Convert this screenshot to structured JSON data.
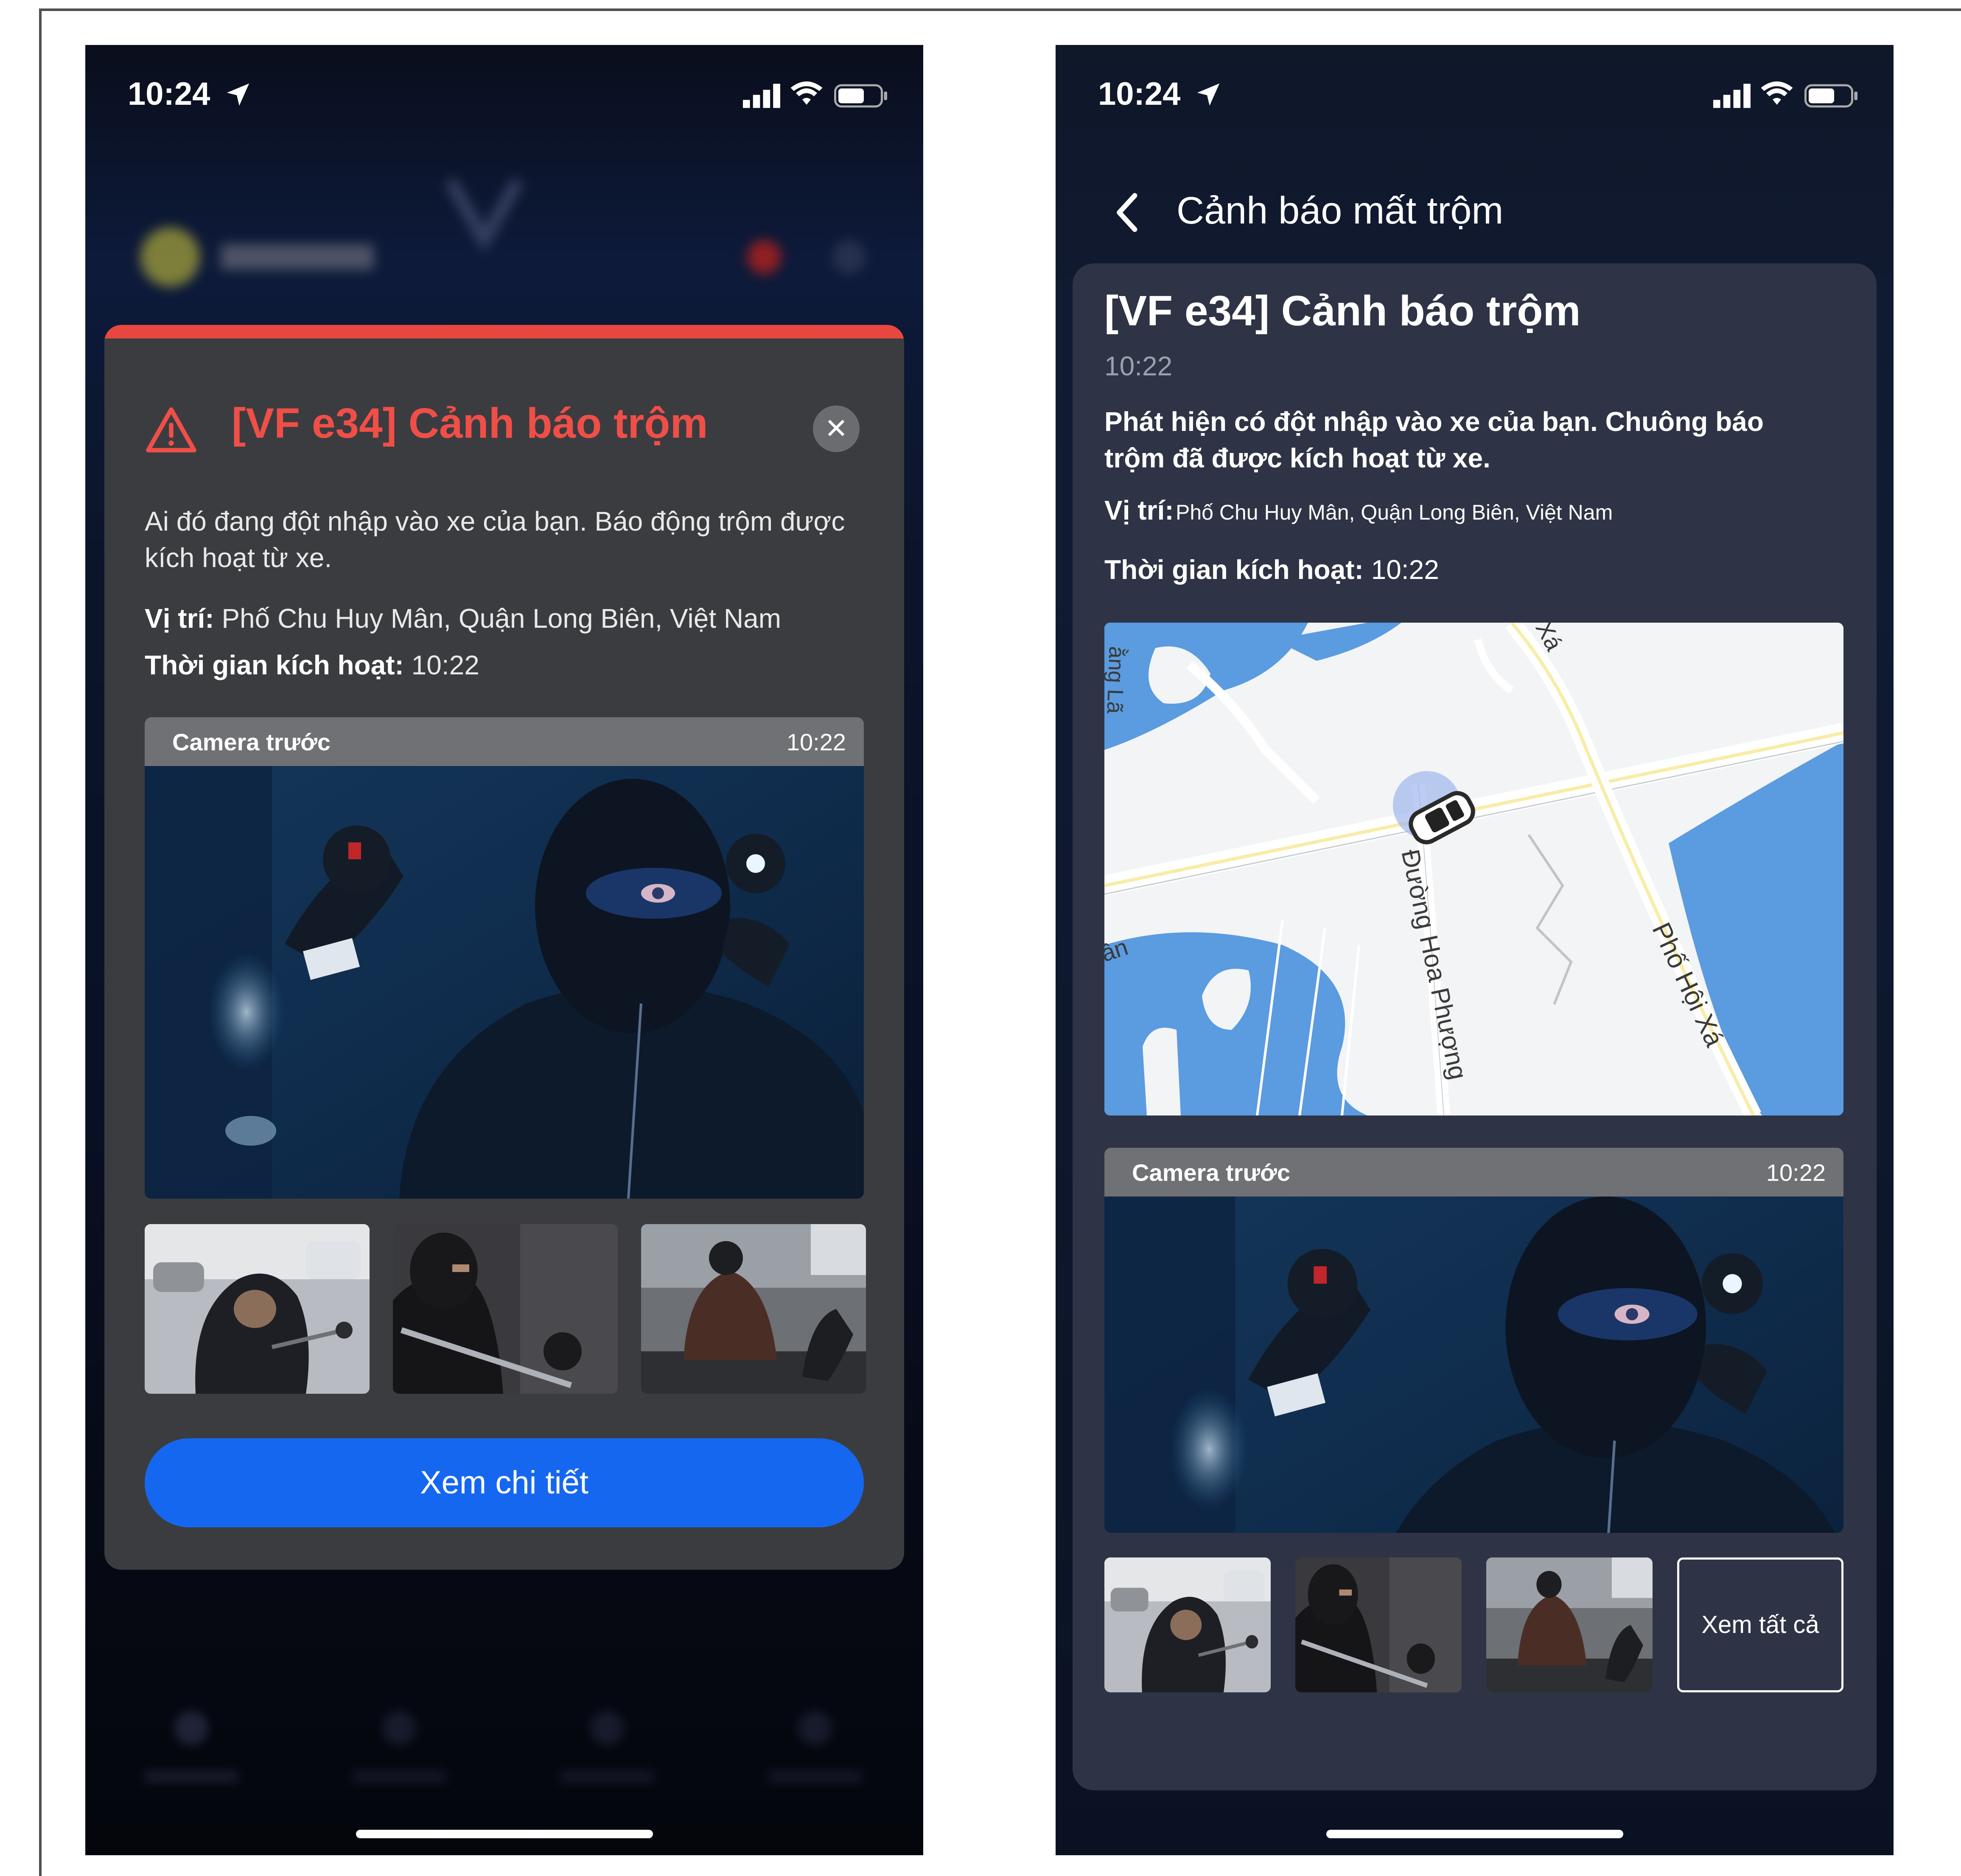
{
  "status_bar": {
    "time": "10:24"
  },
  "alert_popup": {
    "title": "[VF e34] Cảnh báo trộm",
    "description": "Ai đó đang đột nhập vào xe của bạn. Báo động trộm được kích hoạt từ xe.",
    "location_label": "Vị trí:",
    "location_value": "Phố Chu Huy Mân, Quận Long Biên, Việt Nam",
    "activated_label": "Thời gian kích hoạt:",
    "activated_value": "10:22",
    "camera_label": "Camera trước",
    "camera_time": "10:22",
    "button_label": "Xem chi tiết"
  },
  "detail_screen": {
    "nav_title": "Cảnh báo mất trộm",
    "title": "[VF e34] Cảnh báo trộm",
    "time": "10:22",
    "description": "Phát hiện có đột nhập vào xe của bạn. Chuông báo trộm đã được kích hoạt từ xe.",
    "location_label": "Vị trí:",
    "location_value": "Phố Chu Huy Mân, Quận Long Biên, Việt Nam",
    "activated_label": "Thời gian kích hoạt:",
    "activated_value": "10:22",
    "map_labels": {
      "street1": "Đường Hoa Phượng",
      "street2": "Phố Hội Xá",
      "top": "Xá",
      "left": "ân",
      "corner": "ằng Lã"
    },
    "camera_label": "Camera trước",
    "camera_time": "10:22",
    "see_all_label": "Xem tất cả"
  },
  "colors": {
    "alert_red": "#e8473f",
    "primary_blue": "#1667f0",
    "card_gray": "#3b3c40",
    "panel_navy": "#2e3445"
  }
}
